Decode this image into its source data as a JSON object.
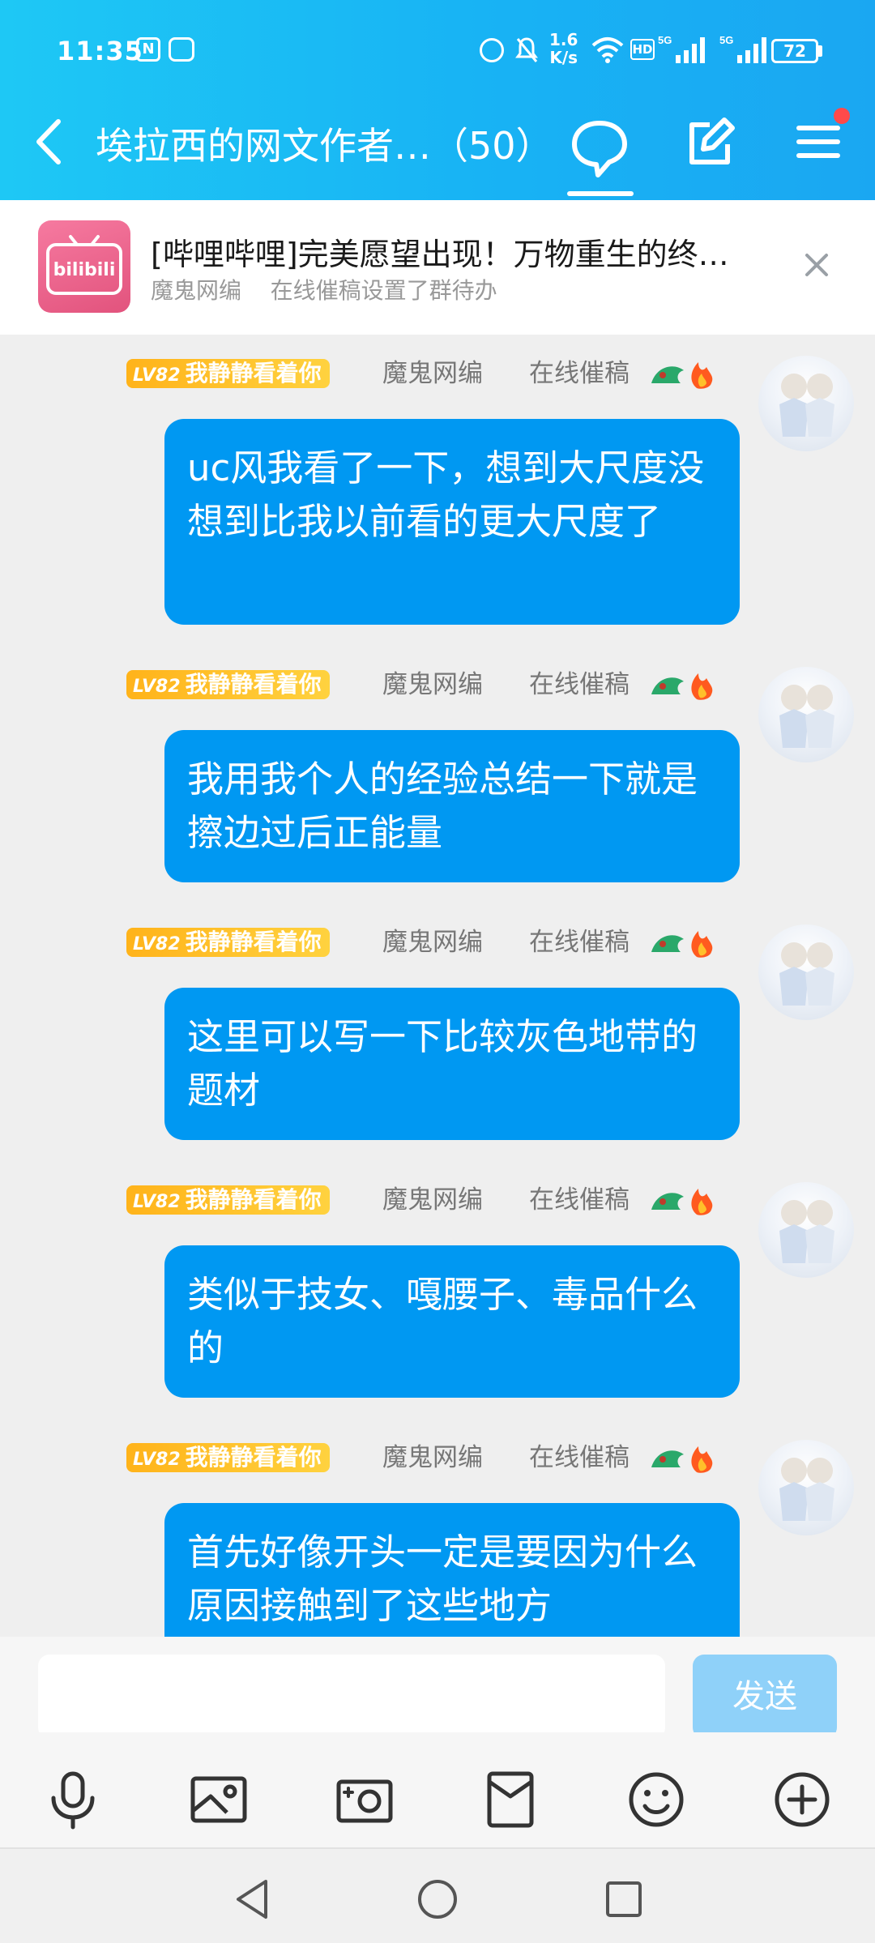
{
  "status_bar": {
    "time": "11:35",
    "net_speed_value": "1.6",
    "net_speed_unit": "K/s",
    "hd": "HD",
    "sim1_label": "5G",
    "sim2_label": "5G",
    "battery": "72"
  },
  "header": {
    "title": "埃拉西的网文作者…（50）",
    "active_tab": "chat"
  },
  "pinned": {
    "logo_text": "bilibili",
    "title": "[哔哩哔哩]完美愿望出现！万物重生的终…",
    "sub_role": "魔鬼网编",
    "sub_action": "在线催稿设置了群待办"
  },
  "messages": [
    {
      "level": "LV82",
      "name": "我静静看着你",
      "role1": "魔鬼网编",
      "role2": "在线催稿",
      "text": "uc风我看了一下，想到大尺度没想到比我以前看的更大尺度了"
    },
    {
      "level": "LV82",
      "name": "我静静看着你",
      "role1": "魔鬼网编",
      "role2": "在线催稿",
      "text": "我用我个人的经验总结一下就是擦边过后正能量"
    },
    {
      "level": "LV82",
      "name": "我静静看着你",
      "role1": "魔鬼网编",
      "role2": "在线催稿",
      "text": "这里可以写一下比较灰色地带的题材"
    },
    {
      "level": "LV82",
      "name": "我静静看着你",
      "role1": "魔鬼网编",
      "role2": "在线催稿",
      "text": "类似于技女、嘎腰子、毒品什么的"
    },
    {
      "level": "LV82",
      "name": "我静静看着你",
      "role1": "魔鬼网编",
      "role2": "在线催稿",
      "text": "首先好像开头一定是要因为什么原因接触到了这些地方"
    }
  ],
  "input": {
    "placeholder": "",
    "send_label": "发送"
  },
  "toolbar": [
    "mic-icon",
    "photo-icon",
    "camera-icon",
    "red-packet-icon",
    "emoji-icon",
    "plus-icon"
  ],
  "colors": {
    "header": "#18b3f4",
    "bubble": "#0098f2",
    "badge": "#ffc62a",
    "send_disabled": "#8fd1f9"
  }
}
